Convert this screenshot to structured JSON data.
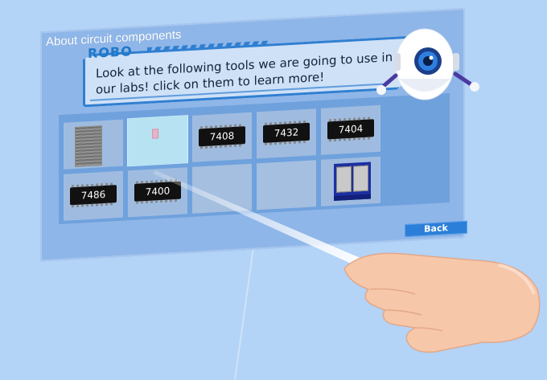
{
  "panel": {
    "title": "About circuit components",
    "speaker": "ROBO",
    "message_line1": "Look at the following tools we are going to use in",
    "message_line2": "our labs! click on them to learn more!",
    "back_label": "Back"
  },
  "components": [
    {
      "id": "breadboard",
      "label": ""
    },
    {
      "id": "probe",
      "label": ""
    },
    {
      "id": "chip-7408",
      "label": "7408"
    },
    {
      "id": "chip-7432",
      "label": "7432"
    },
    {
      "id": "chip-7404",
      "label": "7404"
    },
    {
      "id": "chip-7486",
      "label": "7486"
    },
    {
      "id": "chip-7400",
      "label": "7400"
    },
    {
      "id": "empty-1",
      "label": ""
    },
    {
      "id": "empty-2",
      "label": ""
    },
    {
      "id": "switch",
      "label": ""
    }
  ],
  "colors": {
    "background": "#b3d3f7",
    "panel": "#8fb6e8",
    "accent": "#2f7fd1",
    "button": "#2c7fd8",
    "selected_tile": "#b6e2f2"
  },
  "icons": {
    "robot": "robot-mascot-icon",
    "hand": "vr-hand-pointer",
    "switch": "switch-box-icon",
    "breadboard": "breadboard-icon"
  }
}
